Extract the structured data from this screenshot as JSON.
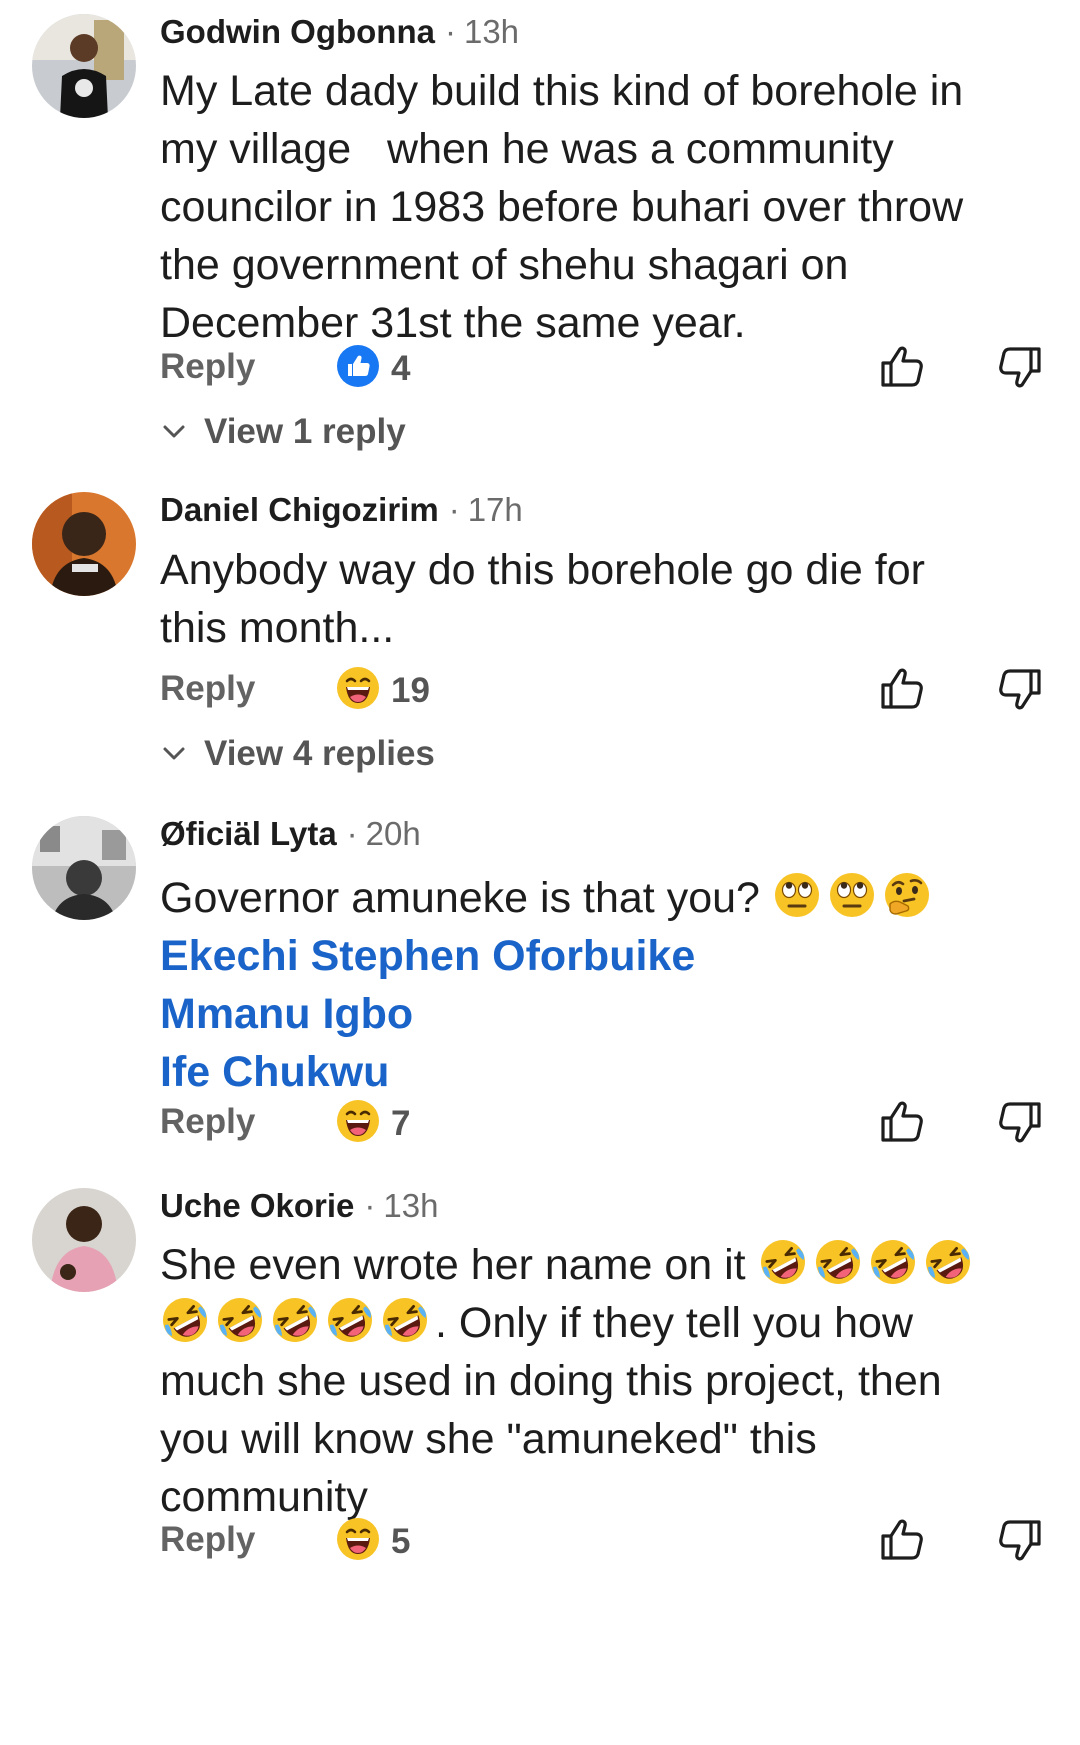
{
  "comments": [
    {
      "author": "Godwin Ogbonna",
      "time": "13h",
      "lines": [
        "My Late dady build this kind of borehole in",
        "my village   when he was a community",
        "councilor in 1983 before buhari over throw",
        "the government of shehu shagari on",
        "December 31st the same year."
      ],
      "reply_label": "Reply",
      "reaction_icon": "like-reaction-icon",
      "reaction_count": "4",
      "view_replies": "View 1 reply"
    },
    {
      "author": "Daniel Chigozirim",
      "time": "17h",
      "lines": [
        "Anybody way do this borehole go die for",
        "this month..."
      ],
      "reply_label": "Reply",
      "reaction_icon": "haha-reaction-icon",
      "reaction_count": "19",
      "view_replies": "View 4 replies"
    },
    {
      "author": "Øficiäl Lyta",
      "time": "20h",
      "lines": [
        "Governor amuneke is that you?"
      ],
      "mentions": [
        "Ekechi Stephen Oforbuike",
        "Mmanu Igbo",
        "Ife Chukwu"
      ],
      "reply_label": "Reply",
      "reaction_icon": "haha-reaction-icon",
      "reaction_count": "7"
    },
    {
      "author": "Uche Okorie",
      "time": "13h",
      "lines": [
        "She even wrote her name on it",
        ". Only if they tell you how",
        "much she used in doing this project, then",
        "you will know she \"amuneked\" this",
        "community"
      ],
      "reply_label": "Reply",
      "reaction_icon": "haha-reaction-icon",
      "reaction_count": "5"
    }
  ],
  "colors": {
    "accent_blue": "#1a64c9",
    "like_blue": "#1877f2",
    "secondary_text": "#6b6b6b",
    "emoji_yellow": "#f7c325"
  }
}
